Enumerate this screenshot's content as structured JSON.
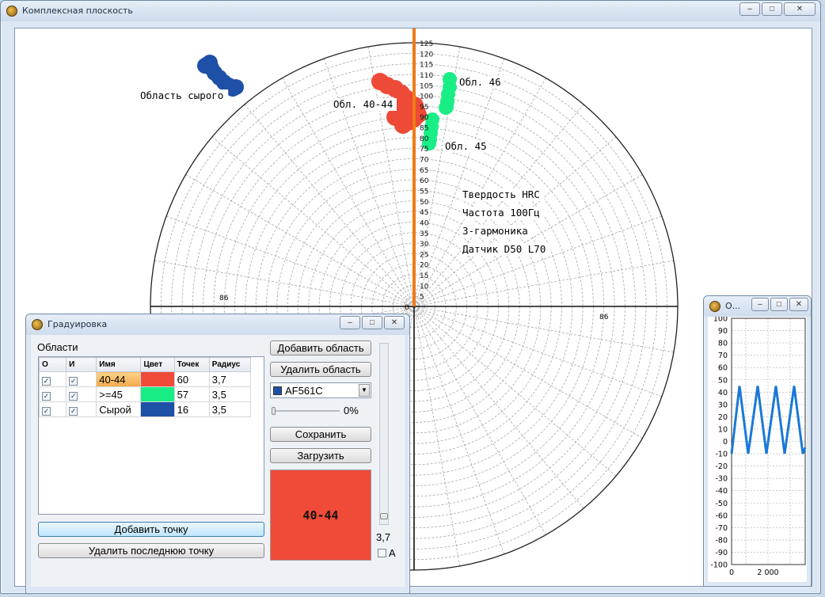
{
  "main_window": {
    "title": "Комплексная плоскость",
    "controls": {
      "minimize": "–",
      "maximize": "□",
      "close": "✕"
    }
  },
  "polar": {
    "radial_ticks": [
      "5",
      "10",
      "15",
      "20",
      "25",
      "30",
      "35",
      "40",
      "45",
      "50",
      "55",
      "60",
      "65",
      "70",
      "75",
      "80",
      "85",
      "90",
      "95",
      "100",
      "105",
      "110",
      "115",
      "120",
      "125"
    ],
    "origin_label": "0",
    "marker_value": "86",
    "left_axis_label": "86",
    "right_axis_label": "86",
    "annotations": {
      "raw": "Область сырого",
      "region_40_44": "Обл. 40-44",
      "region_46": "Обл. 46",
      "region_45": "Обл. 45"
    },
    "info_lines": [
      "Твердость HRC",
      "Частота 100Гц",
      "3-гармоника",
      "Датчик D50 L70"
    ],
    "colors": {
      "red": "#ee4a38",
      "green": "#19ee86",
      "blue": "#1e50a8",
      "marker": "#f07a18"
    }
  },
  "grad_window": {
    "title": "Градуировка",
    "regions_label": "Области",
    "table": {
      "headers": [
        "О",
        "И",
        "Имя",
        "Цвет",
        "Точек",
        "Радиус"
      ],
      "rows": [
        {
          "o": "✓",
          "i": "✓",
          "name": "40-44",
          "color": "#f04a38",
          "points": "60",
          "radius": "3,7"
        },
        {
          "o": "✓",
          "i": "✓",
          "name": ">=45",
          "color": "#19ee86",
          "points": "57",
          "radius": "3,5"
        },
        {
          "o": "✓",
          "i": "✓",
          "name": "Сырой",
          "color": "#1e50a8",
          "points": "16",
          "radius": "3,5"
        }
      ]
    },
    "add_point": "Добавить точку",
    "delete_last_point": "Удалить последнюю точку",
    "add_region": "Добавить область",
    "delete_region": "Удалить область",
    "color_select": "AF561C",
    "color_swatch": "#1e50a8",
    "slider_percent": "0%",
    "save": "Сохранить",
    "load": "Загрузить",
    "preview_label": "40-44",
    "preview_color": "#f04a38",
    "radius_value": "3,7",
    "auto_label": "A"
  },
  "osc_window": {
    "title": "О...",
    "y_ticks": [
      "100",
      "90",
      "80",
      "70",
      "60",
      "50",
      "40",
      "30",
      "20",
      "10",
      "0",
      "-10",
      "-20",
      "-30",
      "-40",
      "-50",
      "-60",
      "-70",
      "-80",
      "-90",
      "-100"
    ],
    "x_ticks": [
      "0",
      "2 000"
    ],
    "line_color": "#1a78d8"
  }
}
